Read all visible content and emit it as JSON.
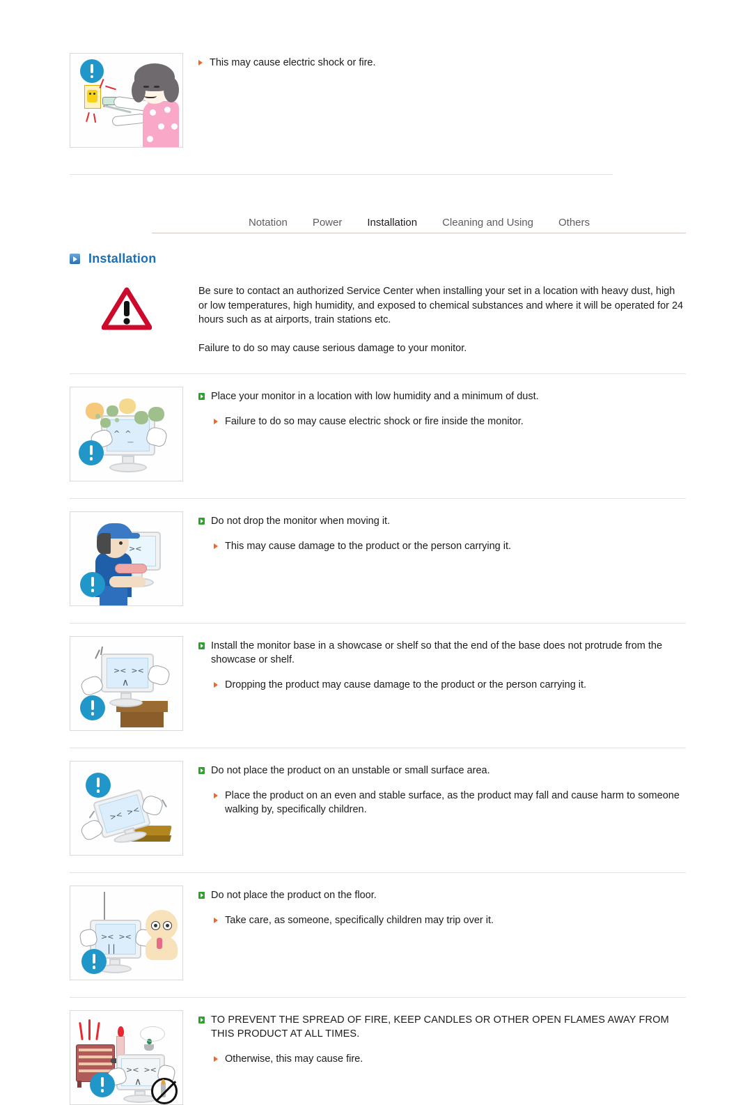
{
  "document": {
    "title": "Installation",
    "top_note": {
      "marker": "orange-arrow",
      "text": "This may cause electric shock or fire."
    }
  },
  "tabs": {
    "items": [
      {
        "label": "Notation",
        "active": false
      },
      {
        "label": "Power",
        "active": false
      },
      {
        "label": "Installation",
        "active": true
      },
      {
        "label": "Cleaning and Using",
        "active": false
      },
      {
        "label": "Others",
        "active": false
      }
    ],
    "active_underline_color": "#1b7fa5",
    "rule_color": "#cfc4c0"
  },
  "heading": {
    "icon": "blue-play-square-icon",
    "text": "Installation",
    "color": "#1b6fb5"
  },
  "intro": {
    "icon": "warning-triangle-icon",
    "paragraphs": [
      "Be sure to contact an authorized Service Center when installing your set in a location with heavy dust, high or low temperatures, high humidity, and exposed to chemical substances and where it will be operated for 24 hours such as at airports, train stations etc.",
      "Failure to do so may cause serious damage to your monitor."
    ]
  },
  "markers": {
    "green": "green-square-arrow-icon",
    "orange": "orange-triangle-arrow-icon",
    "green_color": "#2aa32a",
    "orange_color": "#f26522"
  },
  "sections": [
    {
      "figure": "dusty-monitor-illustration",
      "main": "Place your monitor in a location with low humidity and a minimum of dust.",
      "sub": "Failure to do so may cause electric shock or fire inside the monitor."
    },
    {
      "figure": "man-carrying-monitor-illustration",
      "main": "Do not drop the monitor when moving it.",
      "sub": "This may cause damage to the product or the person carrying it."
    },
    {
      "figure": "monitor-on-shelf-edge-illustration",
      "main": "Install the monitor base in a showcase or shelf so that the end of the base does not protrude from the showcase or shelf.",
      "sub": "Dropping the product may cause damage to the product or the person carrying it."
    },
    {
      "figure": "monitor-tipping-small-surface-illustration",
      "main": "Do not place the product on an unstable or small surface area.",
      "sub": "Place the product on an even and stable surface, as the product may fall and cause harm to someone walking by, specifically children."
    },
    {
      "figure": "monitor-on-floor-with-child-illustration",
      "main": "Do not place the product on the floor.",
      "sub": "Take care, as someone, specifically children may trip over it."
    },
    {
      "figure": "candle-heater-near-monitor-illustration",
      "main": "TO PREVENT THE SPREAD OF FIRE, KEEP CANDLES OR OTHER OPEN FLAMES AWAY FROM THIS PRODUCT AT ALL TIMES.",
      "sub": "Otherwise, this may cause fire."
    }
  ]
}
